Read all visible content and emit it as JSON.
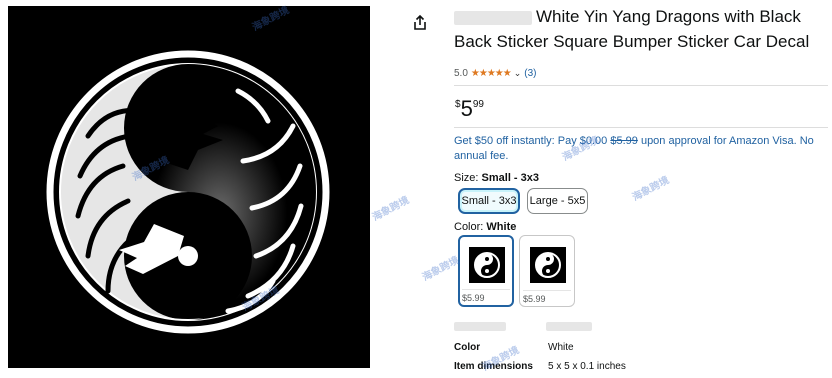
{
  "product": {
    "title": "White Yin Yang Dragons with Black Back Sticker Square Bumper Sticker Car Decal",
    "rating": "5.0",
    "stars": "★★★★★",
    "rating_count": "(3)",
    "price_symbol": "$",
    "price_whole": "5",
    "price_fraction": "99"
  },
  "offer": {
    "lead": "Get $50 off instantly: Pay ",
    "pay_amount": "$0.00",
    "struck_price": "$5.99",
    "tail": " upon approval for Amazon Visa. No annual fee."
  },
  "size": {
    "label": "Size:",
    "selected": "Small - 3x3",
    "options": [
      "Small - 3x3",
      "Large - 5x5"
    ]
  },
  "color": {
    "label": "Color:",
    "selected": "White",
    "swatches": [
      {
        "price": "$5.99"
      },
      {
        "price": "$5.99"
      }
    ]
  },
  "specs": [
    {
      "key": "Color",
      "value": "White"
    },
    {
      "key": "Item dimensions",
      "value": "5 x 5 x 0.1 inches"
    }
  ],
  "watermark": "海象跨境",
  "colors": {
    "link": "#2162a1",
    "star": "#de7921",
    "selected_border": "#2162a1"
  }
}
